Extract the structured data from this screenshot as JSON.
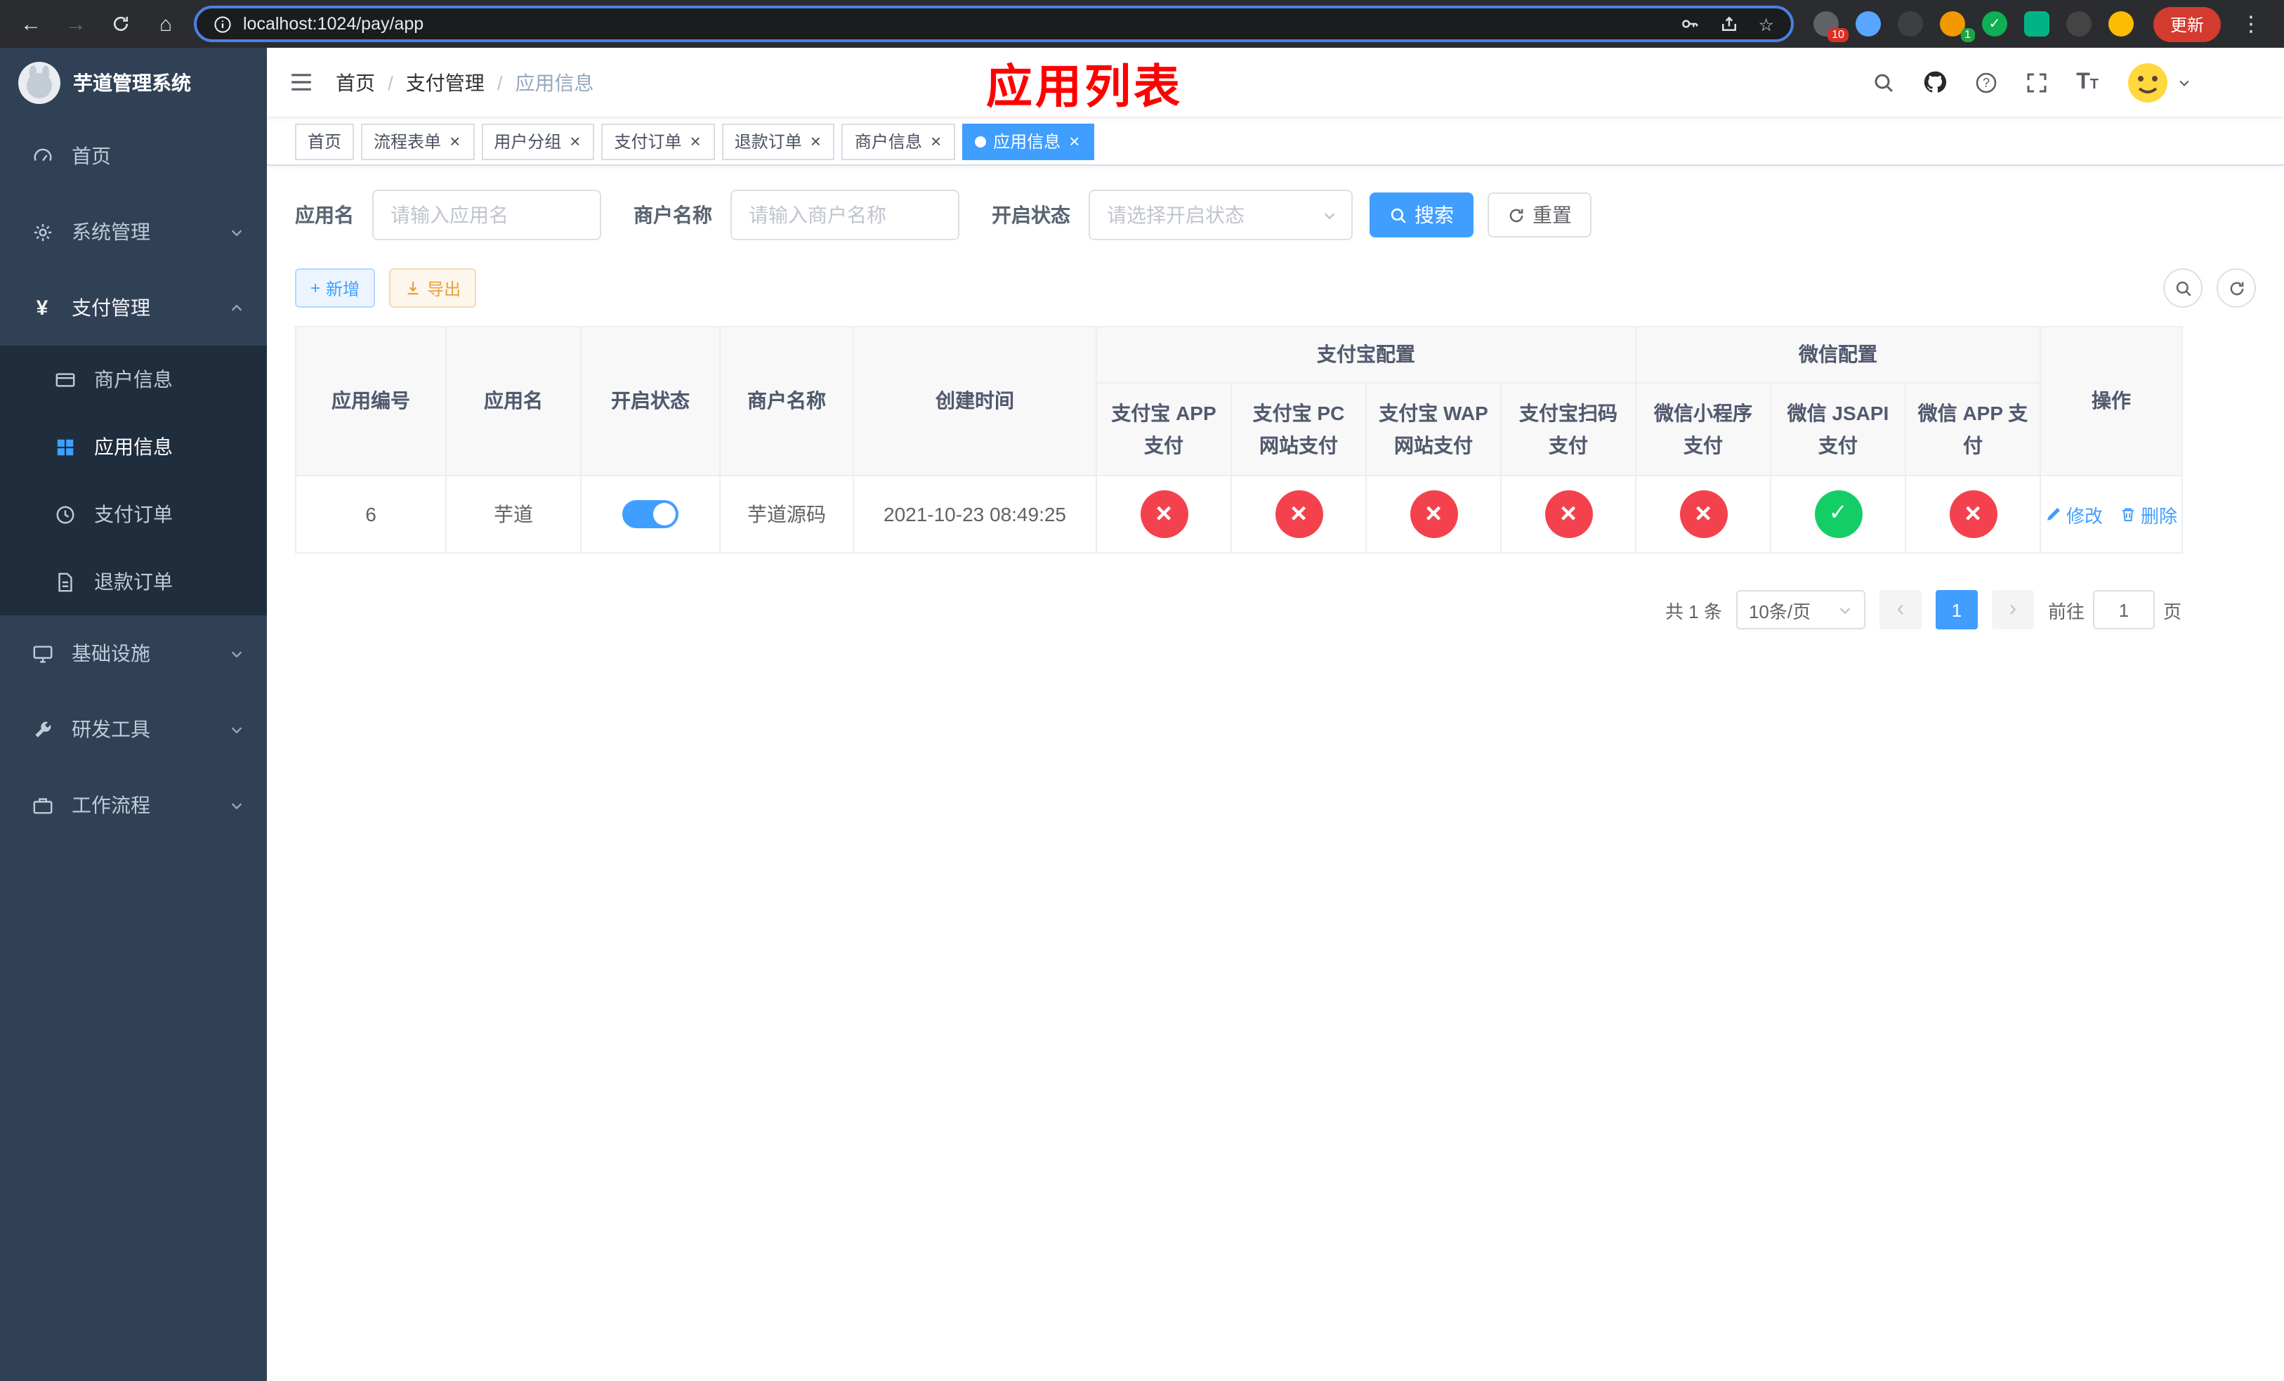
{
  "theme": {
    "primary": "#409EFF",
    "danger": "#f3424d",
    "success": "#13ce66",
    "warning": "#e6a23c",
    "sidebar_bg": "#304156",
    "submenu_bg": "#1f2d3d",
    "annotation_red": "#ff0000"
  },
  "icons": {
    "back": "←",
    "forward": "→",
    "home": "⌂",
    "star": "☆",
    "yen": "¥",
    "close": "×",
    "plus": "+",
    "prev": "‹",
    "next": "›",
    "menu_dots": "⋮",
    "font": "T"
  },
  "browser": {
    "url": "localhost:1024/pay/app",
    "update_button": "更新",
    "extensions_badge": "10",
    "profile_badge": "1"
  },
  "sidebar": {
    "title": "芋道管理系统",
    "items": [
      {
        "label": "首页"
      },
      {
        "label": "系统管理"
      },
      {
        "label": "支付管理",
        "children": [
          {
            "label": "商户信息"
          },
          {
            "label": "应用信息"
          },
          {
            "label": "支付订单"
          },
          {
            "label": "退款订单"
          }
        ]
      },
      {
        "label": "基础设施"
      },
      {
        "label": "研发工具"
      },
      {
        "label": "工作流程"
      }
    ]
  },
  "navbar": {
    "breadcrumb": [
      "首页",
      "支付管理",
      "应用信息"
    ],
    "breadcrumb_separator": "/",
    "annotation": "应用列表"
  },
  "tabs": [
    {
      "label": "首页"
    },
    {
      "label": "流程表单"
    },
    {
      "label": "用户分组"
    },
    {
      "label": "支付订单"
    },
    {
      "label": "退款订单"
    },
    {
      "label": "商户信息"
    },
    {
      "label": "应用信息"
    }
  ],
  "filters": {
    "app_name": {
      "label": "应用名",
      "placeholder": "请输入应用名",
      "value": ""
    },
    "merchant_name": {
      "label": "商户名称",
      "placeholder": "请输入商户名称",
      "value": ""
    },
    "status": {
      "label": "开启状态",
      "placeholder": "请选择开启状态",
      "value": ""
    },
    "search_button": "搜索",
    "reset_button": "重置"
  },
  "toolbar": {
    "add_button": "新增",
    "export_button": "导出"
  },
  "table": {
    "headers": {
      "id": "应用编号",
      "name": "应用名",
      "status": "开启状态",
      "merchant": "商户名称",
      "created": "创建时间",
      "alipay_group": "支付宝配置",
      "alipay_cols": [
        "支付宝 APP 支付",
        "支付宝 PC 网站支付",
        "支付宝 WAP 网站支付",
        "支付宝扫码支付"
      ],
      "wechat_group": "微信配置",
      "wechat_cols": [
        "微信小程序支付",
        "微信 JSAPI 支付",
        "微信 APP 支付"
      ],
      "actions": "操作"
    },
    "rows": [
      {
        "id": "6",
        "name": "芋道",
        "enabled": true,
        "merchant": "芋道源码",
        "created": "2021-10-23 08:49:25",
        "configs": [
          false,
          false,
          false,
          false,
          false,
          true,
          false
        ],
        "edit": "修改",
        "delete": "删除"
      }
    ]
  },
  "pagination": {
    "total": "共 1 条",
    "page_size": "10条/页",
    "page": "1",
    "goto_label": "前往",
    "goto_value": "1",
    "goto_unit": "页"
  }
}
